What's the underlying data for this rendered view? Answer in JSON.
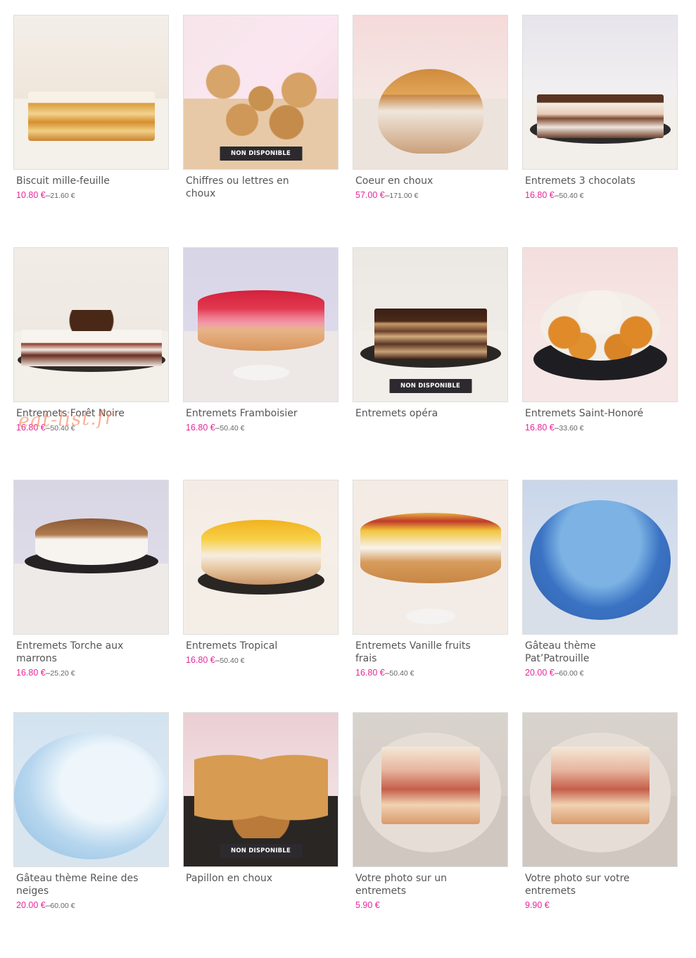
{
  "badge_label": "NON DISPONIBLE",
  "watermark": "eat-list.fr",
  "colors": {
    "price": "#e6299a",
    "name": "#555555",
    "badge_bg": "#2c2a2e"
  },
  "products": [
    {
      "name": "Biscuit mille-feuille",
      "price_from": "10.80 €",
      "price_to": "21.60 €",
      "available": true,
      "image": "mille-feuille-image"
    },
    {
      "name": "Chiffres ou lettres en choux",
      "price_from": "",
      "price_to": "",
      "available": false,
      "image": "choux-numbers-image"
    },
    {
      "name": "Coeur en choux",
      "price_from": "57.00 €",
      "price_to": "171.00 €",
      "available": true,
      "image": "heart-choux-image"
    },
    {
      "name": "Entremets 3 chocolats",
      "price_from": "16.80 €",
      "price_to": "50.40 €",
      "available": true,
      "image": "three-chocolate-image"
    },
    {
      "name": "Entremets Forêt Noire",
      "price_from": "16.80 €",
      "price_to": "50.40 €",
      "available": true,
      "image": "black-forest-image"
    },
    {
      "name": "Entremets Framboisier",
      "price_from": "16.80 €",
      "price_to": "50.40 €",
      "available": true,
      "image": "raspberry-cake-image"
    },
    {
      "name": "Entremets opéra",
      "price_from": "",
      "price_to": "",
      "available": false,
      "image": "opera-cake-image"
    },
    {
      "name": "Entremets Saint-Honoré",
      "price_from": "16.80 €",
      "price_to": "33.60 €",
      "available": true,
      "image": "saint-honore-image"
    },
    {
      "name": "Entremets Torche aux marrons",
      "price_from": "16.80 €",
      "price_to": "25.20 €",
      "available": true,
      "image": "chestnut-cake-image"
    },
    {
      "name": "Entremets Tropical",
      "price_from": "16.80 €",
      "price_to": "50.40 €",
      "available": true,
      "image": "tropical-cake-image"
    },
    {
      "name": "Entremets Vanille fruits frais",
      "price_from": "16.80 €",
      "price_to": "50.40 €",
      "available": true,
      "image": "vanilla-fruit-image"
    },
    {
      "name": "Gâteau thème Pat’Patrouille",
      "price_from": "20.00 €",
      "price_to": "60.00 €",
      "available": true,
      "image": "paw-patrol-cake-image"
    },
    {
      "name": "Gâteau thème Reine des neiges",
      "price_from": "20.00 €",
      "price_to": "60.00 €",
      "available": true,
      "image": "frozen-cake-image"
    },
    {
      "name": "Papillon en choux",
      "price_from": "",
      "price_to": "",
      "available": false,
      "image": "butterfly-choux-image"
    },
    {
      "name": "Votre photo sur un entremets",
      "price_from": "5.90 €",
      "price_to": "",
      "available": true,
      "image": "photo-cake-image"
    },
    {
      "name": "Votre photo sur votre entremets",
      "price_from": "9.90 €",
      "price_to": "",
      "available": true,
      "image": "photo-cake-2-image"
    }
  ]
}
